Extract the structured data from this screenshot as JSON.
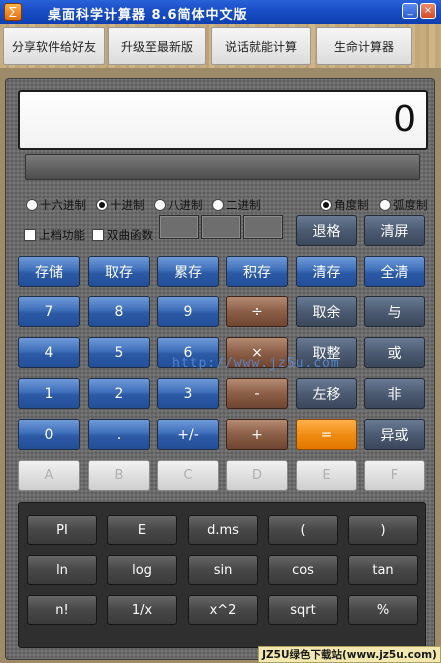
{
  "window": {
    "title": "桌面科学计算器 8.6简体中文版",
    "minimize": "_",
    "close": "×"
  },
  "toolbar": [
    "分享软件给好友",
    "升级至最新版",
    "说话就能计算",
    "生命计算器"
  ],
  "display": {
    "value": "0"
  },
  "radix": {
    "options": [
      "十六进制",
      "十进制",
      "八进制",
      "二进制"
    ],
    "selected": "十进制"
  },
  "angle": {
    "options": [
      "角度制",
      "弧度制"
    ],
    "selected": "角度制"
  },
  "checkboxes": [
    {
      "label": "上档功能",
      "checked": false
    },
    {
      "label": "双曲函数",
      "checked": false
    }
  ],
  "keys": {
    "backspace": "退格",
    "clear_screen": "清屏",
    "row_memory": [
      "存储",
      "取存",
      "累存",
      "积存",
      "清存",
      "全清"
    ],
    "row1": [
      "7",
      "8",
      "9",
      "÷",
      "取余",
      "与"
    ],
    "row2": [
      "4",
      "5",
      "6",
      "×",
      "取整",
      "或"
    ],
    "row3": [
      "1",
      "2",
      "3",
      "-",
      "左移",
      "非"
    ],
    "row4": [
      "0",
      ".",
      "+/-",
      "+",
      "=",
      "异或"
    ],
    "hex": [
      "A",
      "B",
      "C",
      "D",
      "E",
      "F"
    ]
  },
  "scientific": {
    "rows": [
      [
        "PI",
        "E",
        "d.ms",
        "(",
        ")"
      ],
      [
        "ln",
        "log",
        "sin",
        "cos",
        "tan"
      ],
      [
        "n!",
        "1/x",
        "x^2",
        "sqrt",
        "%"
      ]
    ]
  },
  "watermark": "http://www.jz5u.com",
  "footer": "JZ5U绿色下载站(www.jz5u.com)",
  "colors": {
    "accent_blue": "#2d5aa5",
    "operator_brown": "#8b5f47",
    "equals_orange": "#f08a10",
    "titlebar": "#1a4fc8"
  }
}
